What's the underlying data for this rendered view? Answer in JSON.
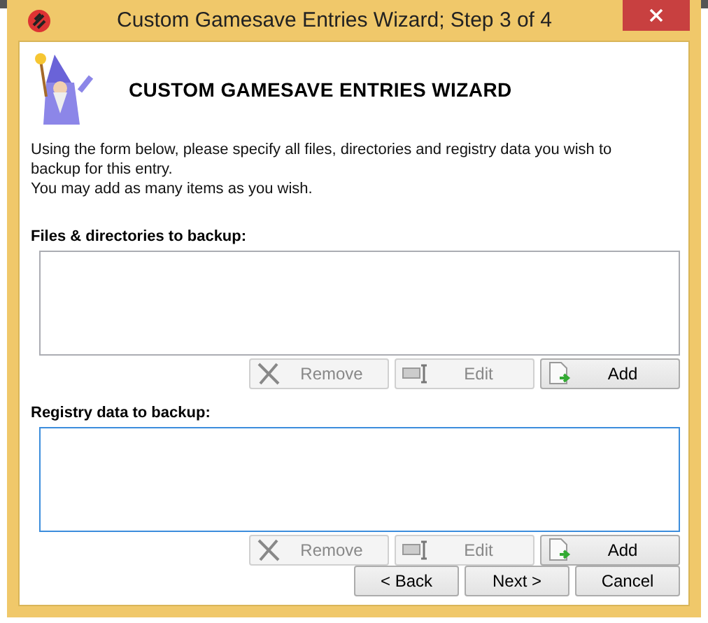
{
  "window": {
    "title": "Custom Gamesave Entries Wizard; Step 3 of 4"
  },
  "header": {
    "title": "CUSTOM GAMESAVE ENTRIES WIZARD"
  },
  "intro": [
    "Using the form below, please specify all files, directories and registry data you wish to backup for this entry.",
    "You may add as many items as you wish."
  ],
  "sections": [
    {
      "label": "Files & directories to backup:",
      "focused": false,
      "buttons": [
        {
          "kind": "remove",
          "label": "Remove",
          "disabled": true
        },
        {
          "kind": "edit",
          "label": "Edit",
          "disabled": true
        },
        {
          "kind": "add",
          "label": "Add",
          "disabled": false
        }
      ]
    },
    {
      "label": "Registry data to backup:",
      "focused": true,
      "buttons": [
        {
          "kind": "remove",
          "label": "Remove",
          "disabled": true
        },
        {
          "kind": "edit",
          "label": "Edit",
          "disabled": true
        },
        {
          "kind": "add",
          "label": "Add",
          "disabled": false
        }
      ]
    }
  ],
  "footer_buttons": [
    "< Back",
    "Next >",
    "Cancel"
  ]
}
